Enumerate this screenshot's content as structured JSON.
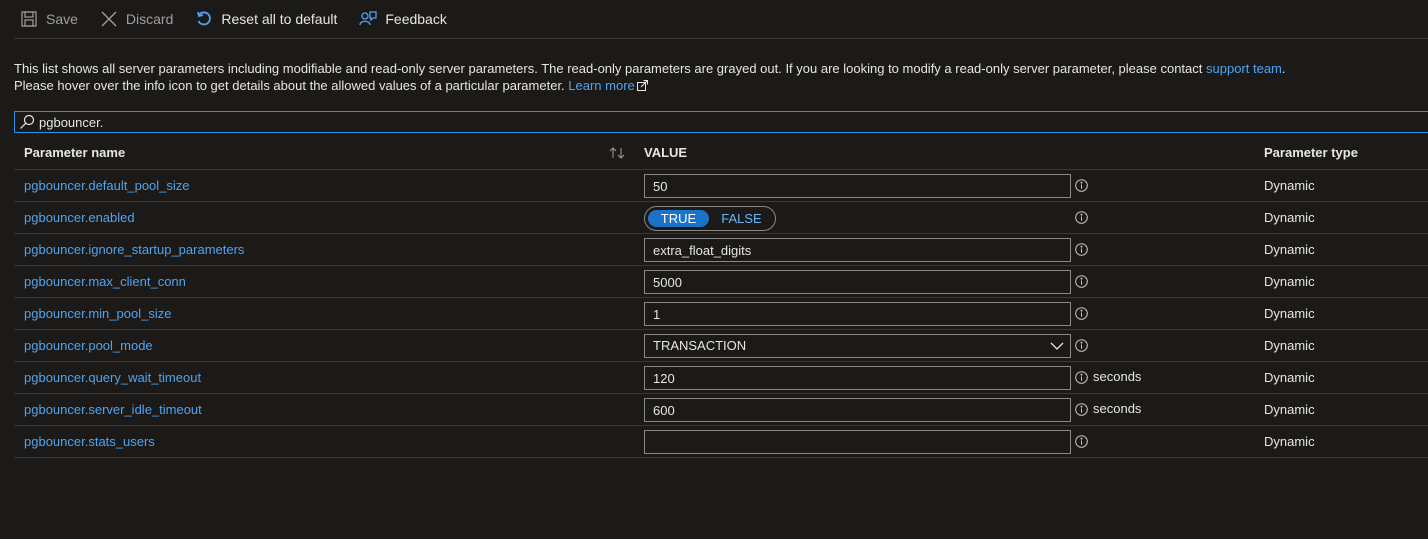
{
  "toolbar": {
    "save": "Save",
    "discard": "Discard",
    "reset": "Reset all to default",
    "feedback": "Feedback"
  },
  "description": {
    "line1": "This list shows all server parameters including modifiable and read-only server parameters. The read-only parameters are grayed out. If you are looking to modify a read-only server parameter, please contact ",
    "support_link": "support team",
    "line1_end": ".",
    "line2": "Please hover over the info icon to get details about the allowed values of a particular parameter. ",
    "learn_more": "Learn more"
  },
  "search": {
    "value": "pgbouncer."
  },
  "table": {
    "headers": {
      "name": "Parameter name",
      "value": "VALUE",
      "type": "Parameter type"
    },
    "rows": [
      {
        "name": "pgbouncer.default_pool_size",
        "value": "50",
        "type": "Dynamic"
      },
      {
        "name": "pgbouncer.enabled",
        "toggle_on": "TRUE",
        "toggle_off": "FALSE",
        "type": "Dynamic"
      },
      {
        "name": "pgbouncer.ignore_startup_parameters",
        "value": "extra_float_digits",
        "type": "Dynamic"
      },
      {
        "name": "pgbouncer.max_client_conn",
        "value": "5000",
        "type": "Dynamic"
      },
      {
        "name": "pgbouncer.min_pool_size",
        "value": "1",
        "type": "Dynamic"
      },
      {
        "name": "pgbouncer.pool_mode",
        "value": "TRANSACTION",
        "type": "Dynamic"
      },
      {
        "name": "pgbouncer.query_wait_timeout",
        "value": "120",
        "unit": "seconds",
        "type": "Dynamic"
      },
      {
        "name": "pgbouncer.server_idle_timeout",
        "value": "600",
        "unit": "seconds",
        "type": "Dynamic"
      },
      {
        "name": "pgbouncer.stats_users",
        "value": "",
        "type": "Dynamic"
      }
    ]
  },
  "colors": {
    "background": "#1b1a19",
    "link": "#4fa3f0",
    "accent": "#2f8fe8",
    "border": "#3b3a39"
  }
}
